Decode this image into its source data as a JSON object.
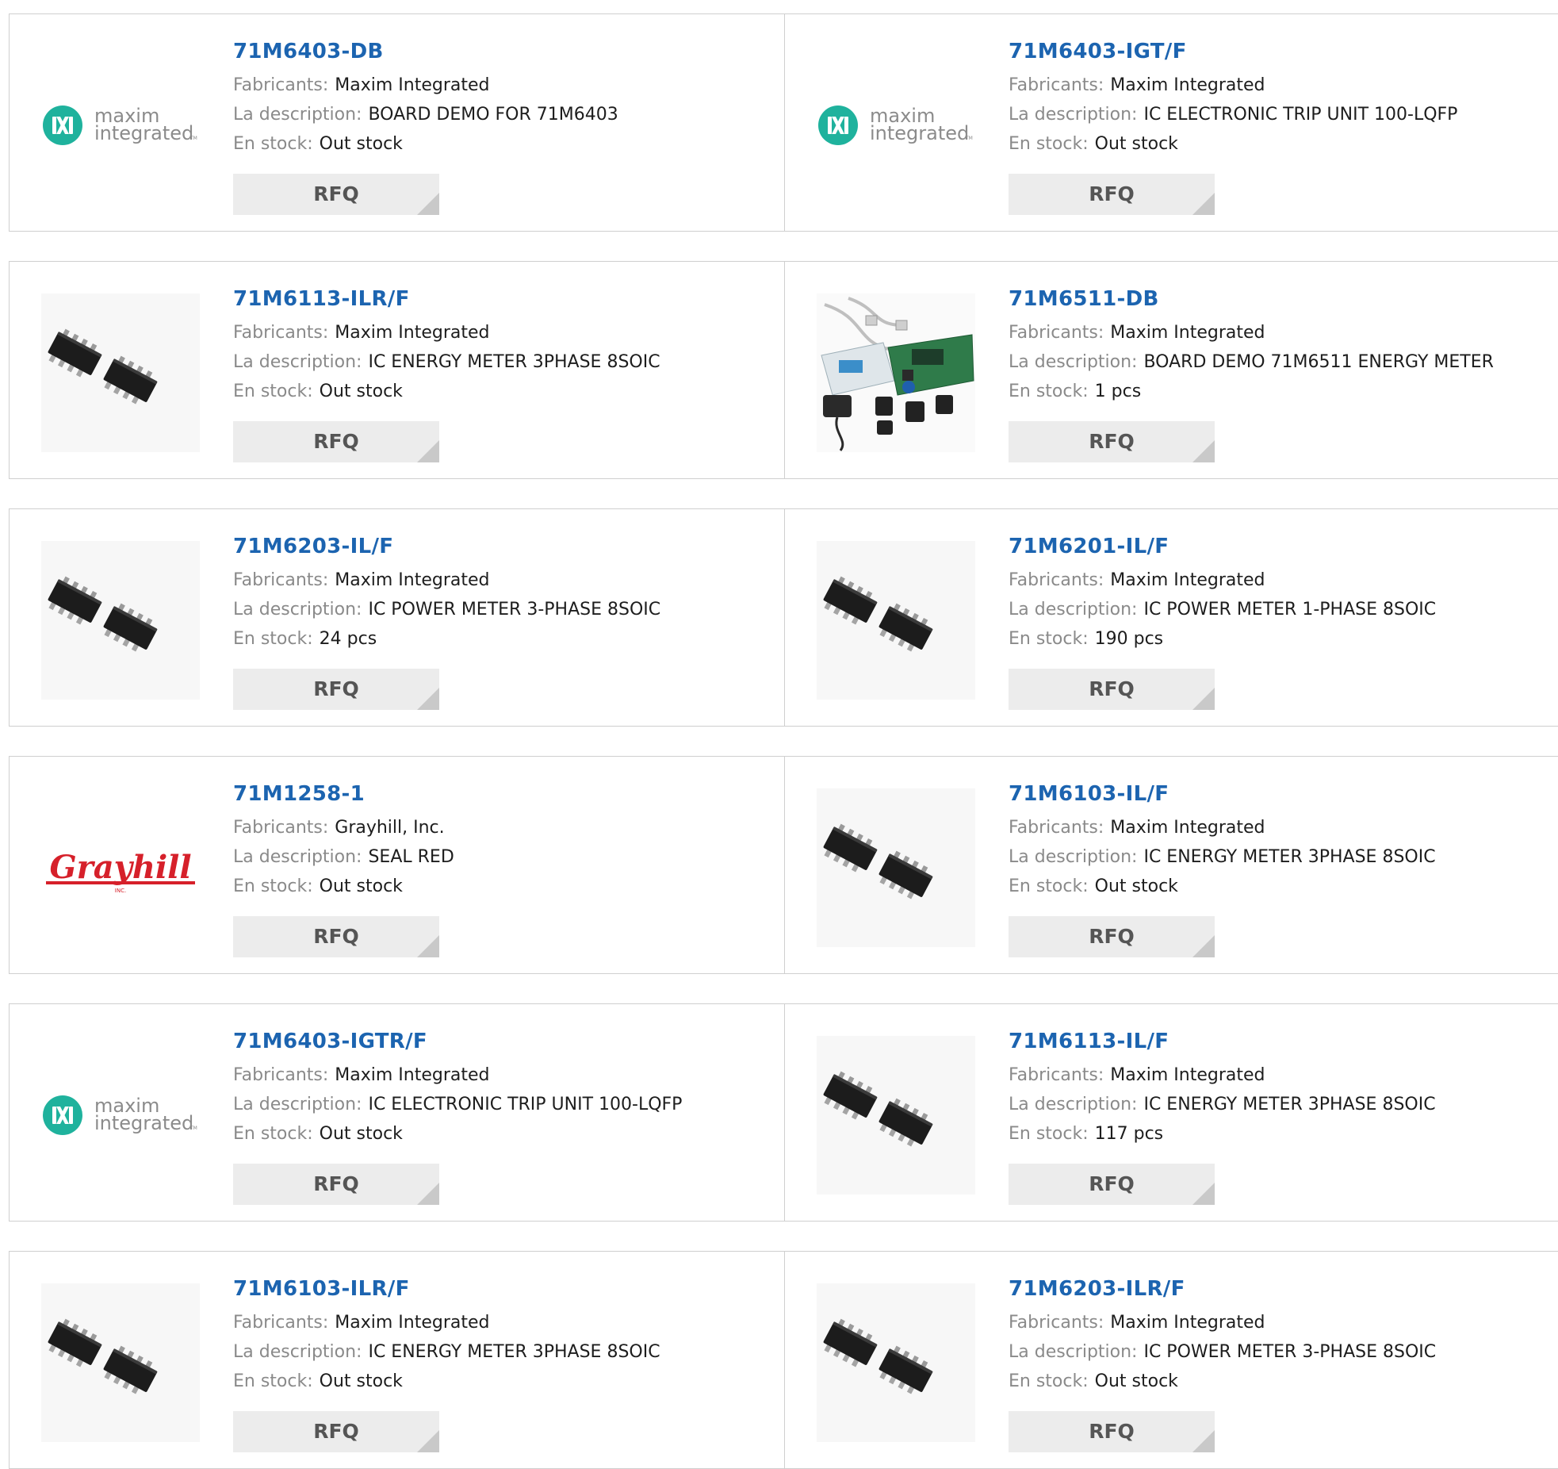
{
  "labels": {
    "manufacturer": "Fabricants:",
    "description": "La description:",
    "stock": "En stock:",
    "rfq": "RFQ"
  },
  "colors": {
    "part_link": "#1c64b0",
    "label": "#8a8a8a",
    "rfq_background": "#ececec",
    "maxim_logo": "#1fb29d",
    "grayhill_logo": "#d6202a"
  },
  "products": [
    {
      "part_number": "71M6403-DB",
      "manufacturer": "Maxim Integrated",
      "description": "BOARD DEMO FOR 71M6403",
      "stock": "Out stock",
      "image": "maxim-logo",
      "image_text": [
        "maxim",
        "integrated",
        "TM"
      ]
    },
    {
      "part_number": "71M6403-IGT/F",
      "manufacturer": "Maxim Integrated",
      "description": "IC ELECTRONIC TRIP UNIT 100-LQFP",
      "stock": "Out stock",
      "image": "maxim-logo",
      "image_text": [
        "maxim",
        "integrated",
        "TM"
      ]
    },
    {
      "part_number": "71M6113-ILR/F",
      "manufacturer": "Maxim Integrated",
      "description": "IC ENERGY METER 3PHASE 8SOIC",
      "stock": "Out stock",
      "image": "soic-chip-photo"
    },
    {
      "part_number": "71M6511-DB",
      "manufacturer": "Maxim Integrated",
      "description": "BOARD DEMO 71M6511 ENERGY METER",
      "stock": "1 pcs",
      "image": "demo-board-kit-photo"
    },
    {
      "part_number": "71M6203-IL/F",
      "manufacturer": "Maxim Integrated",
      "description": "IC POWER METER 3-PHASE 8SOIC",
      "stock": "24 pcs",
      "image": "soic-chip-photo"
    },
    {
      "part_number": "71M6201-IL/F",
      "manufacturer": "Maxim Integrated",
      "description": "IC POWER METER 1-PHASE 8SOIC",
      "stock": "190 pcs",
      "image": "soic-chip-photo"
    },
    {
      "part_number": "71M1258-1",
      "manufacturer": "Grayhill, Inc.",
      "description": "SEAL RED",
      "stock": "Out stock",
      "image": "grayhill-logo",
      "image_text": [
        "Grayhill",
        "INC."
      ]
    },
    {
      "part_number": "71M6103-IL/F",
      "manufacturer": "Maxim Integrated",
      "description": "IC ENERGY METER 3PHASE 8SOIC",
      "stock": "Out stock",
      "image": "soic-chip-photo"
    },
    {
      "part_number": "71M6403-IGTR/F",
      "manufacturer": "Maxim Integrated",
      "description": "IC ELECTRONIC TRIP UNIT 100-LQFP",
      "stock": "Out stock",
      "image": "maxim-logo",
      "image_text": [
        "maxim",
        "integrated",
        "TM"
      ]
    },
    {
      "part_number": "71M6113-IL/F",
      "manufacturer": "Maxim Integrated",
      "description": "IC ENERGY METER 3PHASE 8SOIC",
      "stock": "117 pcs",
      "image": "soic-chip-photo"
    },
    {
      "part_number": "71M6103-ILR/F",
      "manufacturer": "Maxim Integrated",
      "description": "IC ENERGY METER 3PHASE 8SOIC",
      "stock": "Out stock",
      "image": "soic-chip-photo"
    },
    {
      "part_number": "71M6203-ILR/F",
      "manufacturer": "Maxim Integrated",
      "description": "IC POWER METER 3-PHASE 8SOIC",
      "stock": "Out stock",
      "image": "soic-chip-photo"
    }
  ]
}
